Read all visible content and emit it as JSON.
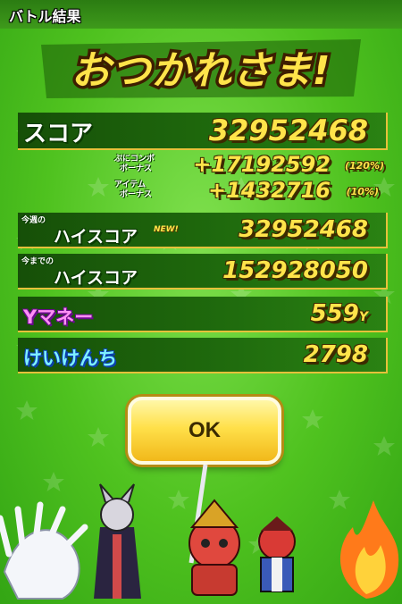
{
  "header": {
    "title": "バトル結果"
  },
  "main_title": "おつかれさま!",
  "rows": {
    "score": {
      "label": "スコア",
      "value": "32952468"
    },
    "combo_bonus": {
      "label_line1": "ぷにコンボ",
      "label_line2": "ボーナス",
      "value": "+17192592",
      "percent": "(120%)"
    },
    "item_bonus": {
      "label_line1": "アイテム",
      "label_line2": "ボーナス",
      "value": "+1432716",
      "percent": "(10%)"
    },
    "week_high": {
      "label_small": "今週の",
      "label": "ハイスコア",
      "badge": "NEW!",
      "value": "32952468"
    },
    "all_high": {
      "label_small": "今までの",
      "label": "ハイスコア",
      "value": "152928050"
    },
    "money": {
      "label": "Yマネー",
      "value": "559",
      "unit": "Y"
    },
    "exp": {
      "label": "けいけんち",
      "value": "2798"
    }
  },
  "ok_button": {
    "label": "OK"
  },
  "characters": [
    "white-nine-tail-fox",
    "dark-robed-oni",
    "samurai-cat-hero",
    "red-oni-warrior",
    "flame-spirit"
  ],
  "colors": {
    "background": "#4fc21f",
    "value_yellow": "#ffe44a",
    "panel_dark": "#164f08",
    "money_pink": "#ff8ff5",
    "exp_cyan": "#7ff0ff"
  }
}
